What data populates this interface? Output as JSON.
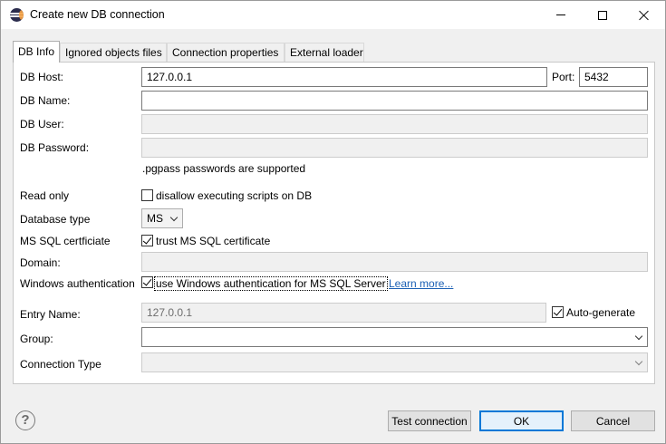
{
  "window": {
    "title": "Create new DB connection"
  },
  "tabs": [
    "DB Info",
    "Ignored objects files",
    "Connection properties",
    "External loader"
  ],
  "form": {
    "host_label": "DB Host:",
    "host_value": "127.0.0.1",
    "port_label": "Port:",
    "port_value": "5432",
    "name_label": "DB Name:",
    "name_value": "",
    "user_label": "DB User:",
    "user_value": "",
    "password_label": "DB Password:",
    "password_value": "",
    "pgpass_note": ".pgpass passwords are supported",
    "readonly_label": "Read only",
    "readonly_check_label": "disallow executing scripts on DB",
    "readonly_checked": false,
    "dbtype_label": "Database type",
    "dbtype_value": "MS",
    "cert_label": "MS SQL certficiate",
    "cert_check_label": "trust MS SQL certificate",
    "cert_checked": true,
    "domain_label": "Domain:",
    "domain_value": "",
    "winauth_label": "Windows authentication",
    "winauth_check_label": "use Windows authentication for MS SQL Server",
    "winauth_checked": true,
    "learn_more": "Learn more...",
    "entry_label": "Entry Name:",
    "entry_value": "127.0.0.1",
    "autogen_label": "Auto-generate",
    "autogen_checked": true,
    "group_label": "Group:",
    "group_value": "",
    "conntype_label": "Connection Type",
    "conntype_value": ""
  },
  "buttons": {
    "help": "?",
    "test": "Test connection",
    "ok": "OK",
    "cancel": "Cancel"
  }
}
